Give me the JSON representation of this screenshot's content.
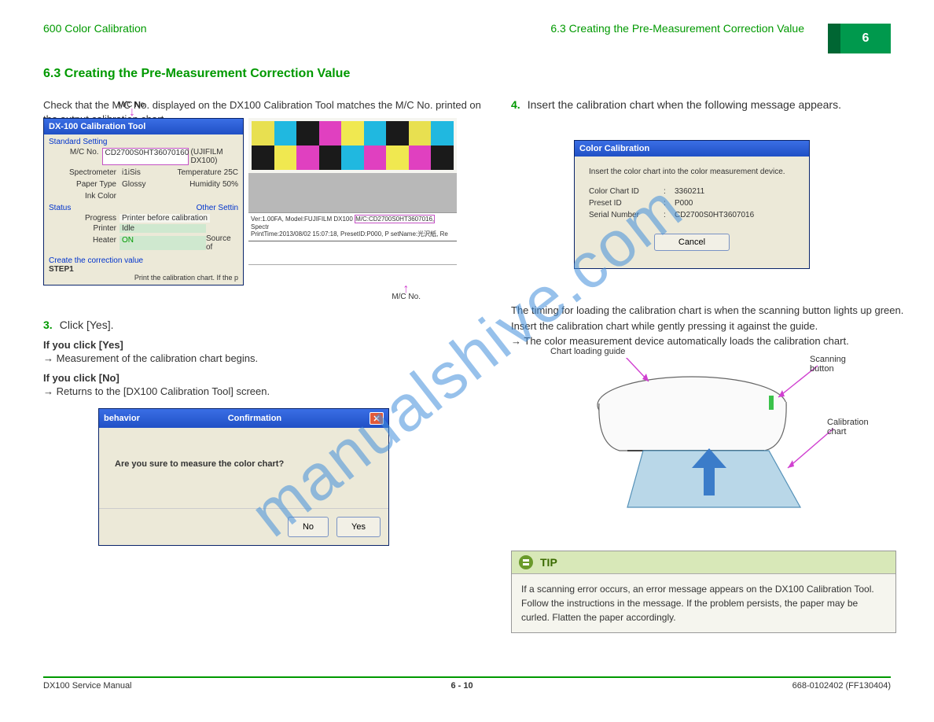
{
  "header": {
    "left": "600 Color Calibration",
    "right": "6.3 Creating the Pre-Measurement Correction Value",
    "badge": "6"
  },
  "section_title": "6.3 Creating the Pre-Measurement Correction Value",
  "left": {
    "step2_pre": "Check that the M/C No. displayed on the DX100 Calibration Tool matches the M/C No. printed on the output calibration chart.",
    "arrow_label_1": "M/C No.",
    "arrow_label_2": "M/C No.",
    "calib": {
      "title": "DX-100 Calibration Tool",
      "grp_std": "Standard Setting",
      "mcn_label": "M/C No.",
      "mcn_value": "CD2700S0HT36070160",
      "mcn_suffix": "(UJIFILM DX100)",
      "spec_label": "Spectrometer",
      "spec_value": "i1iSis",
      "temp_label": "Temperature",
      "temp_value": "25C",
      "paper_label": "Paper Type",
      "paper_value": "Glossy",
      "hum_label": "Humidity",
      "hum_value": "50%",
      "ink_label": "Ink Color",
      "grp_status": "Status",
      "grp_other": "Other Settin",
      "progress_label": "Progress",
      "progress_value": "Printer before calibration",
      "printer_label": "Printer",
      "printer_value": "Idle",
      "heater_label": "Heater",
      "heater_value": "ON",
      "source_label": "Source of",
      "grp_create": "Create the correction value",
      "step_label": "STEP1",
      "step_text": "Print the calibration chart. If the p"
    },
    "chart": {
      "line1": "Ver:1.00FA, Model:FUJIFILM DX100",
      "mc_hl": "M/C:CD2700S0HT3607016,",
      "line1_tail": "Spectr",
      "line2": "PrintTime:2013/08/02 15:07:18, PresetID:P000, P  setName:光沢紙, Re"
    },
    "step3_num": "3.",
    "step3_text": "Click [Yes].",
    "step3_note": "→ Measurement of the calibration chart begins.",
    "step_yes_title": "If you click [Yes]",
    "step_yes_text": "→ Measurement of the calibration chart begins.",
    "step_no_title": "If you click [No]",
    "step_no_text": "→ Returns to the [DX100 Calibration Tool] screen.",
    "confirm": {
      "title": "Confirmation",
      "msg": "Are you sure to measure the color chart?",
      "no": "No",
      "yes": "Yes"
    }
  },
  "right": {
    "step4_num": "4.",
    "step4_text": "Insert the calibration chart when the following message appears.",
    "cc": {
      "title": "Color Calibration",
      "msg": "Insert the color chart into the color measurement device.",
      "chart_id_label": "Color Chart ID",
      "chart_id_value": "3360211",
      "preset_label": "Preset ID",
      "preset_value": "P000",
      "serial_label": "Serial Number",
      "serial_value": "CD2700S0HT3607016",
      "cancel": "Cancel"
    },
    "step5_1": "The timing for loading the calibration chart is when the scanning button lights up green.",
    "step5_2": "Insert the calibration chart while gently pressing it against the guide.",
    "step5_3": "→ The color measurement device automatically loads the calibration chart.",
    "label_guide": "Chart loading guide",
    "label_scan": "Scanning button",
    "label_chart": "Calibration chart",
    "tip_title": "TIP",
    "tip_text": "If a scanning error occurs, an error message appears on the DX100 Calibration Tool. Follow the instructions in the message. If the problem persists, the paper may be curled. Flatten the paper accordingly."
  },
  "footer": {
    "left": "DX100 Service Manual",
    "page": "6 - 10",
    "right": "668-0102402 (FF130404)"
  }
}
